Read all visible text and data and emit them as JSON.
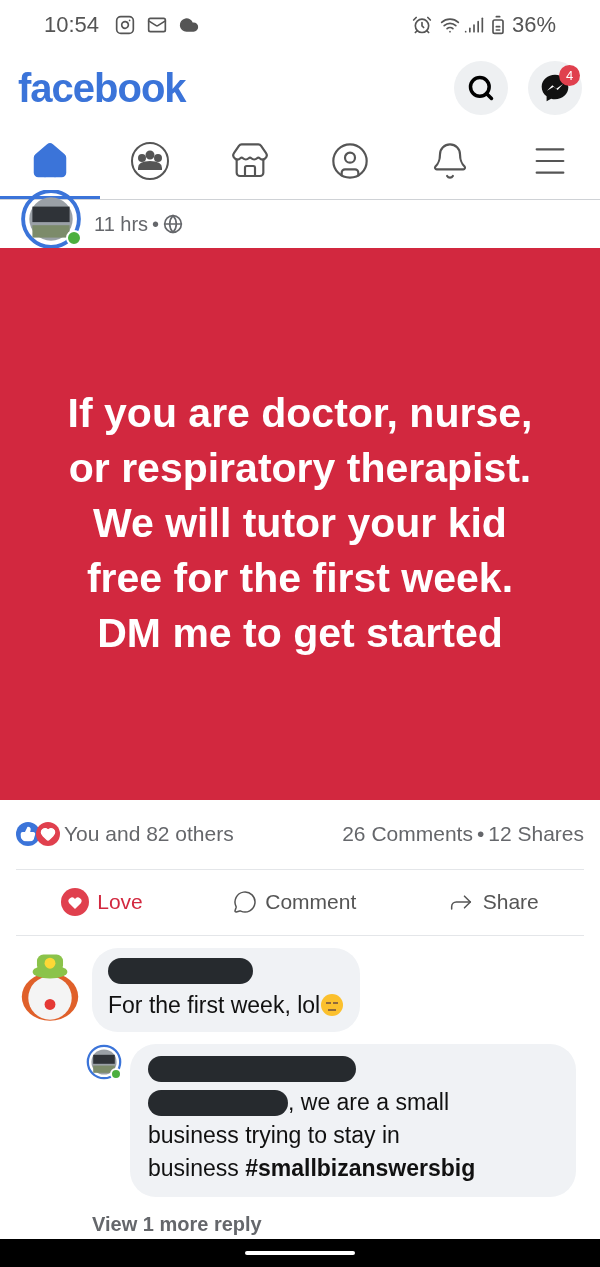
{
  "status_bar": {
    "time": "10:54",
    "battery": "36%"
  },
  "header": {
    "logo": "facebook",
    "messages_badge": "4"
  },
  "tabs": [
    {
      "kind": "home",
      "selected": true
    },
    {
      "kind": "groups",
      "selected": false
    },
    {
      "kind": "marketplace",
      "selected": false
    },
    {
      "kind": "profile",
      "selected": false
    },
    {
      "kind": "notifications",
      "selected": false
    },
    {
      "kind": "menu",
      "selected": false
    }
  ],
  "post": {
    "time": "11 hrs",
    "separator": "•",
    "text": "If you are doctor, nurse, or respiratory therapist. We will tutor your kid free for the first week. DM me to get started",
    "reactions": "You and 82 others",
    "comments": "26 Comments",
    "shares": "12 Shares",
    "actions": [
      {
        "kind": "love",
        "label": "Love",
        "selected": true
      },
      {
        "kind": "comment",
        "label": "Comment",
        "selected": false
      },
      {
        "kind": "share",
        "label": "Share",
        "selected": false
      }
    ]
  },
  "comments": [
    {
      "kind": "comment",
      "text": "For the first week, lol"
    },
    {
      "kind": "reply",
      "lines": [
        ", we are a small",
        "business trying to stay in",
        "business **#smallbizanswersbig**"
      ]
    }
  ],
  "more_replies": "View 1 more reply"
}
